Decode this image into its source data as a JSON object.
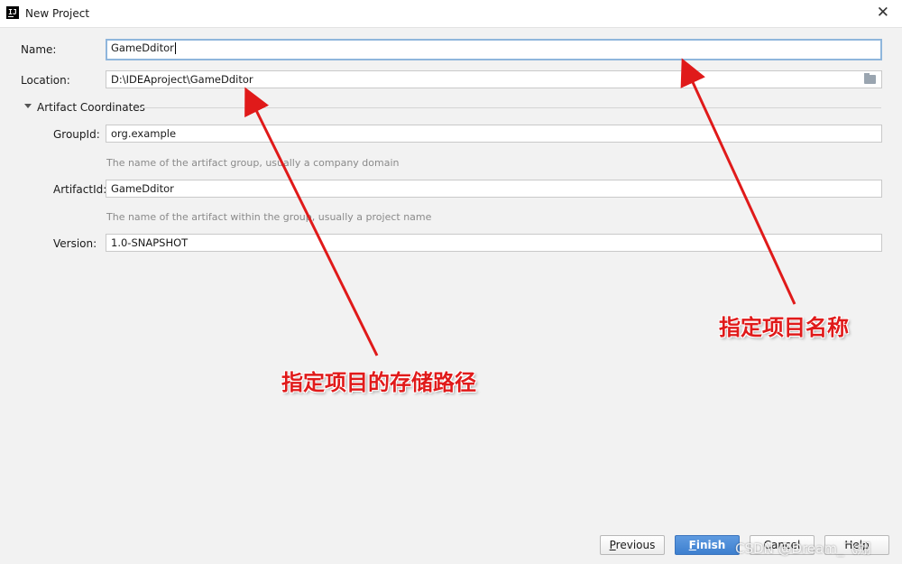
{
  "window": {
    "title": "New Project",
    "app_icon_text": "IJ",
    "close_glyph": "✕"
  },
  "form": {
    "name_label": "Name:",
    "name_value": "GameDditor",
    "location_label": "Location:",
    "location_value": "D:\\IDEAproject\\GameDditor",
    "section_title": "Artifact Coordinates",
    "groupid_label": "GroupId:",
    "groupid_value": "org.example",
    "groupid_hint": "The name of the artifact group, usually a company domain",
    "artifactid_label": "ArtifactId:",
    "artifactid_value": "GameDditor",
    "artifactid_hint": "The name of the artifact within the group, usually a project name",
    "version_label": "Version:",
    "version_value": "1.0-SNAPSHOT"
  },
  "buttons": {
    "previous_mn": "P",
    "previous_rest": "revious",
    "finish_mn": "F",
    "finish_rest": "inish",
    "cancel": "Cancel",
    "help": "Help"
  },
  "annotations": {
    "project_name": "指定项目名称",
    "storage_path": "指定项目的存储路径",
    "arrow_color": "#e01a1a"
  },
  "watermark": "CSDN @Dream_飞翔",
  "icons": {
    "folder": "folder-icon",
    "collapse": "triangle-down-icon",
    "close": "close-icon"
  }
}
